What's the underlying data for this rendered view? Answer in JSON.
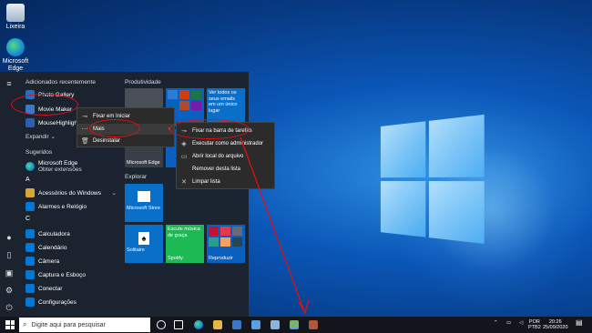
{
  "desktop": {
    "icons": [
      {
        "label": "Lixeira",
        "icon": "recycle-bin-icon"
      },
      {
        "label": "Microsoft Edge",
        "icon": "edge-icon"
      }
    ]
  },
  "start_menu": {
    "recent_header": "Adicionados recentemente",
    "recent_apps": [
      {
        "label": "Photo Gallery",
        "color": "#1e73c9"
      },
      {
        "label": "Movie Maker",
        "color": "#3a78c8"
      },
      {
        "label": "MouseHighlight",
        "color": "#2f5fb0"
      }
    ],
    "expand_label": "Expandir",
    "suggestions_header": "Sugeridos",
    "suggestion": {
      "title": "Microsoft Edge",
      "subtitle": "Obter extensões"
    },
    "letter_a": "A",
    "a_apps": [
      {
        "label": "Acessórios do Windows"
      },
      {
        "label": "Alarmes e Relógio"
      }
    ],
    "letter_c": "C",
    "c_apps": [
      {
        "label": "Calculadora"
      },
      {
        "label": "Calendário"
      },
      {
        "label": "Câmera"
      },
      {
        "label": "Captura e Esboço"
      },
      {
        "label": "Conectar"
      },
      {
        "label": "Configurações"
      }
    ],
    "tiles_header_productivity": "Produtividade",
    "tiles_header_explore": "Explorar",
    "tiles": {
      "mail_promo": "Ver todos os seus emails em um único lugar",
      "edge": "Microsoft Edge",
      "store": "Microsoft Store",
      "spotify_promo": "Escute música de graça",
      "spotify": "Spotify",
      "solitaire": "Solitaire",
      "play": "Reproduzir"
    }
  },
  "context_menu_1": {
    "items": [
      {
        "label": "Fixar em Iniciar",
        "icon": "pin-icon"
      },
      {
        "label": "Mais",
        "icon": "more-icon"
      },
      {
        "label": "Desinstalar",
        "icon": "trash-icon"
      }
    ]
  },
  "context_menu_2": {
    "items": [
      {
        "label": "Fixar na barra de tarefas",
        "icon": "pin-icon"
      },
      {
        "label": "Executar como administrador",
        "icon": "shield-icon"
      },
      {
        "label": "Abrir local do arquivo",
        "icon": "folder-icon"
      },
      {
        "label": "Remover desta lista",
        "icon": "none"
      },
      {
        "label": "Limpar lista",
        "icon": "close-icon"
      }
    ]
  },
  "taskbar": {
    "search_placeholder": "Digite aqui para pesquisar",
    "language": "POR",
    "layout": "PTB2",
    "time": "20:26",
    "date": "25/09/2020"
  },
  "colors": {
    "accent": "#0078d7",
    "annotation": "#e01010"
  }
}
